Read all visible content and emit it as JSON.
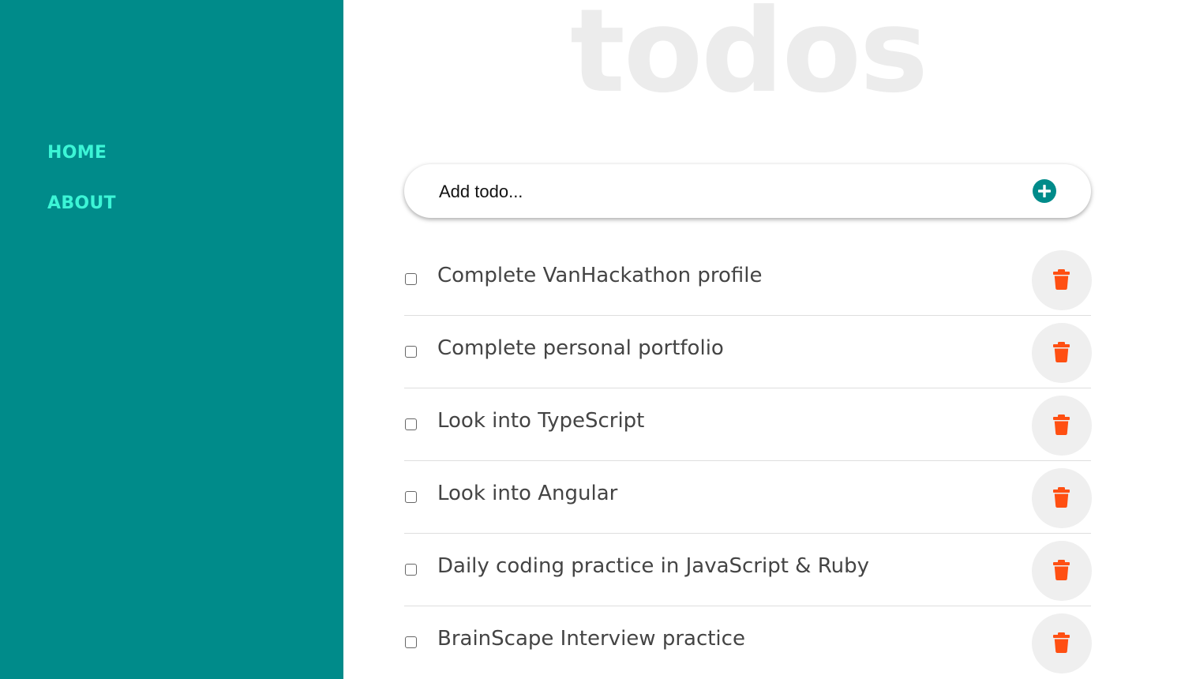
{
  "sidebar": {
    "nav": [
      {
        "label": "HOME"
      },
      {
        "label": "ABOUT"
      }
    ]
  },
  "app": {
    "title": "todos"
  },
  "add_form": {
    "placeholder": "Add todo...",
    "button_icon": "plus-circle-icon"
  },
  "todos": [
    {
      "text": "Complete VanHackathon profile",
      "completed": false
    },
    {
      "text": "Complete personal portfolio",
      "completed": false
    },
    {
      "text": "Look into TypeScript",
      "completed": false
    },
    {
      "text": "Look into Angular",
      "completed": false
    },
    {
      "text": "Daily coding practice in JavaScript & Ruby",
      "completed": false
    },
    {
      "text": "BrainScape Interview practice",
      "completed": false
    }
  ],
  "icons": {
    "delete": "trash-icon"
  },
  "colors": {
    "sidebar_bg": "#008b8a",
    "nav_text": "#3cf5d6",
    "title_text": "#ececec",
    "delete_icon": "#ff4f12",
    "add_icon": "#008b8a"
  }
}
